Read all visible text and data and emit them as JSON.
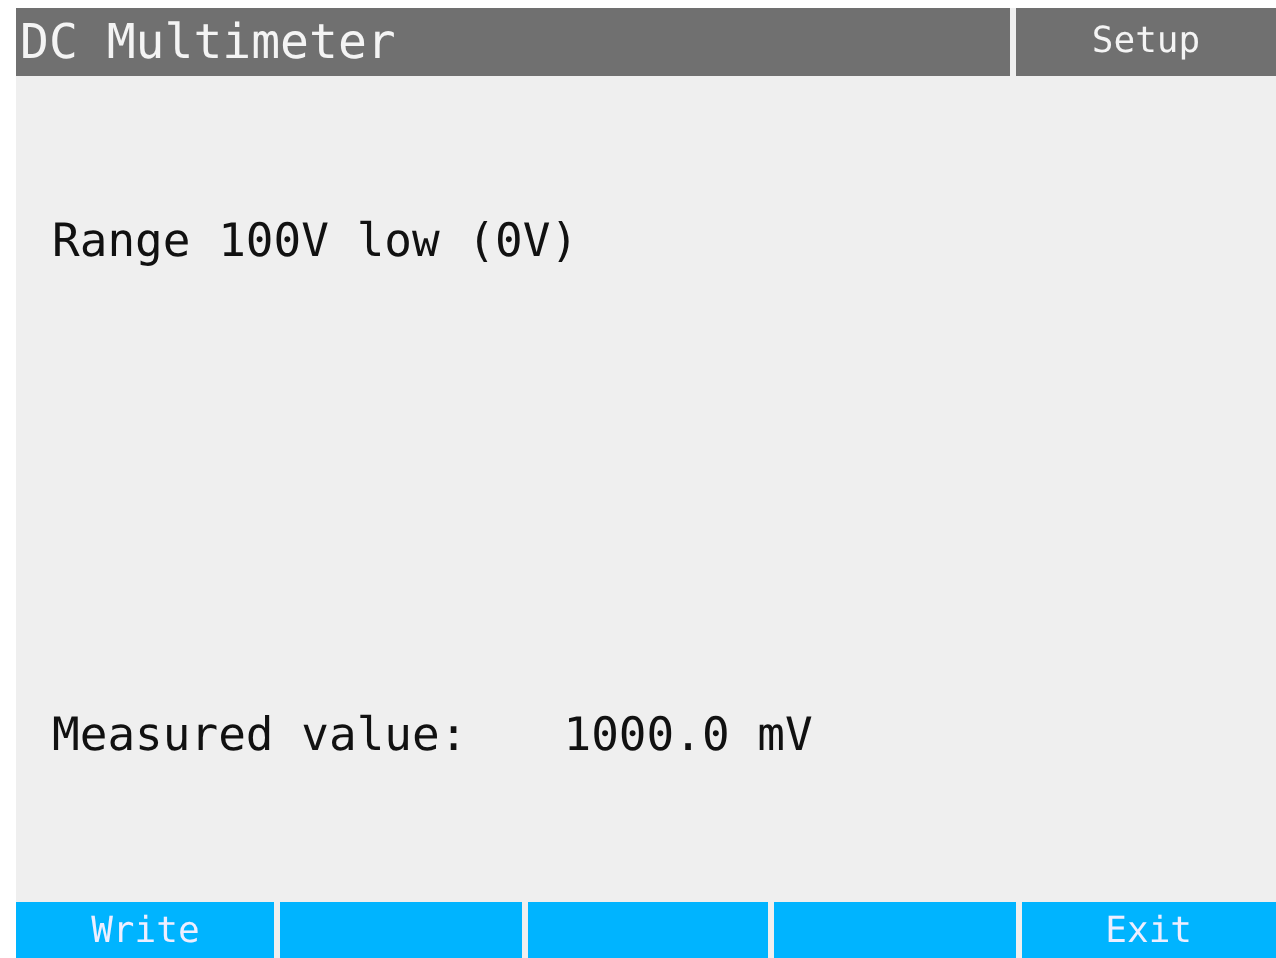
{
  "header": {
    "title": "DC Multimeter",
    "menu": "Setup"
  },
  "range_text": "Range 100V low (0V)",
  "measurement": {
    "label": "Measured value:",
    "value": "1000.0 mV"
  },
  "softkeys": {
    "left": "Write",
    "right": "Exit"
  }
}
